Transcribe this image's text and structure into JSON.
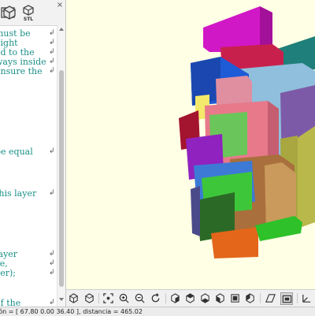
{
  "editor": {
    "toolbar": {
      "stl_label": "STL",
      "close_glyph": "×"
    },
    "lines": [
      {
        "text": "must be",
        "wrapped": true
      },
      {
        "text": "eight",
        "wrapped": false
      },
      {
        "text": "ed to the",
        "wrapped": true
      },
      {
        "text": "ways inside",
        "wrapped": true
      },
      {
        "text": "ensure the",
        "wrapped": true
      },
      {
        "text": "be equal",
        "wrapped": true
      },
      {
        "text": "e",
        "wrapped": false
      },
      {
        "text": "this layer",
        "wrapped": true
      },
      {
        "text": ",",
        "wrapped": false
      },
      {
        "text": "layer",
        "wrapped": true
      },
      {
        "text": "ze,",
        "wrapped": false
      },
      {
        "text": "yer);",
        "wrapped": false
      },
      {
        "text": "of the",
        "wrapped": true
      }
    ],
    "wrap_glyph": "↲"
  },
  "view_toolbar": {
    "buttons": [
      "view-all-icon",
      "reset-view-icon",
      "zoom-fit-icon",
      "zoom-in-icon",
      "zoom-out-icon",
      "rotate-icon",
      "view-right-icon",
      "view-top-icon",
      "view-bottom-icon",
      "view-left-icon",
      "view-front-icon",
      "view-back-icon",
      "perspective-icon",
      "orthogonal-icon",
      "show-axes-icon"
    ]
  },
  "status": {
    "text": "ión = [ 67.80 0.00 36.40 ], distancia = 465.02"
  },
  "colors": {
    "viewport_bg": "#ffffe5",
    "code_text": "#1b8f87"
  }
}
